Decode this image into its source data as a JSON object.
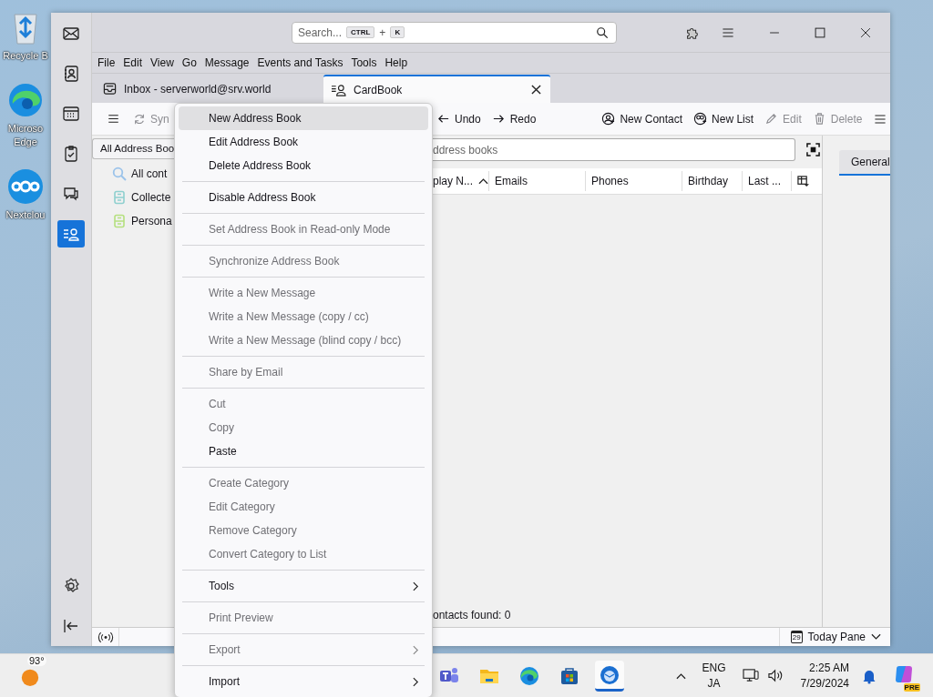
{
  "desktop_icons": [
    {
      "kind": "recycle",
      "label": "Recycle B"
    },
    {
      "kind": "edge",
      "label": "Microso Edge"
    },
    {
      "kind": "nextcloud",
      "label": "Nextclou"
    }
  ],
  "window": {
    "spaces": [
      {
        "kind": "mail",
        "selected": false
      },
      {
        "kind": "contacts",
        "selected": false
      },
      {
        "kind": "calendar",
        "selected": false
      },
      {
        "kind": "tasks",
        "selected": false
      },
      {
        "kind": "chat",
        "selected": false
      },
      {
        "kind": "cardbook",
        "selected": true
      }
    ],
    "search": {
      "placeholder": "Search...",
      "shortcut_keys": [
        "CTRL",
        "K"
      ],
      "shortcut_joiner": "+"
    },
    "menu_bar": [
      "File",
      "Edit",
      "View",
      "Go",
      "Message",
      "Events and Tasks",
      "Tools",
      "Help"
    ],
    "tabs": [
      {
        "kind": "mail",
        "label": "Inbox - serverworld@srv.world",
        "selected": false
      },
      {
        "kind": "cardbook",
        "label": "CardBook",
        "selected": true
      }
    ],
    "toolbar_left": [
      {
        "kind": "sync",
        "label": "Syn",
        "disabled": true
      }
    ],
    "toolbar_right": [
      {
        "kind": "undo",
        "label": "Undo",
        "disabled": false
      },
      {
        "kind": "redo",
        "label": "Redo",
        "disabled": false
      },
      {
        "kind": "new-contact",
        "label": "New Contact",
        "disabled": false
      },
      {
        "kind": "new-list",
        "label": "New List",
        "disabled": false
      },
      {
        "kind": "edit",
        "label": "Edit",
        "disabled": true
      },
      {
        "kind": "delete",
        "label": "Delete",
        "disabled": true
      }
    ],
    "address_book_select": "All Address Boo",
    "address_books": [
      {
        "kind": "search",
        "label": "All cont"
      },
      {
        "kind": "book",
        "label": "Collecte",
        "color": "#8fd0cf"
      },
      {
        "kind": "book",
        "label": "Persona",
        "color": "#b5e07f"
      }
    ],
    "filter": {
      "placeholder": "ddress books"
    },
    "columns": [
      {
        "label": "play N...",
        "sorted": true
      },
      {
        "label": "Emails",
        "sorted": false
      },
      {
        "label": "Phones",
        "sorted": false
      },
      {
        "label": "Birthday",
        "sorted": false
      },
      {
        "label": "Last ...",
        "sorted": false
      }
    ],
    "contacts_count": "ontacts found: 0",
    "detail_tabs": [
      {
        "label": "General",
        "selected": true
      }
    ],
    "status_bar": {
      "calendar_day": "29",
      "today_pane": "Today Pane"
    }
  },
  "context_menu": [
    {
      "kind": "item",
      "label": "New Address Book",
      "disabled": false,
      "selected": true,
      "submenu": false
    },
    {
      "kind": "item",
      "label": "Edit Address Book",
      "disabled": false,
      "selected": false,
      "submenu": false
    },
    {
      "kind": "item",
      "label": "Delete Address Book",
      "disabled": false,
      "selected": false,
      "submenu": false
    },
    {
      "kind": "separator"
    },
    {
      "kind": "item",
      "label": "Disable Address Book",
      "disabled": false,
      "selected": false,
      "submenu": false
    },
    {
      "kind": "separator"
    },
    {
      "kind": "item",
      "label": "Set Address Book in Read-only Mode",
      "disabled": true,
      "selected": false,
      "submenu": false
    },
    {
      "kind": "separator"
    },
    {
      "kind": "item",
      "label": "Synchronize Address Book",
      "disabled": true,
      "selected": false,
      "submenu": false
    },
    {
      "kind": "separator"
    },
    {
      "kind": "item",
      "label": "Write a New Message",
      "disabled": true,
      "selected": false,
      "submenu": false
    },
    {
      "kind": "item",
      "label": "Write a New Message (copy / cc)",
      "disabled": true,
      "selected": false,
      "submenu": false
    },
    {
      "kind": "item",
      "label": "Write a New Message (blind copy / bcc)",
      "disabled": true,
      "selected": false,
      "submenu": false
    },
    {
      "kind": "separator"
    },
    {
      "kind": "item",
      "label": "Share by Email",
      "disabled": true,
      "selected": false,
      "submenu": false
    },
    {
      "kind": "separator"
    },
    {
      "kind": "item",
      "label": "Cut",
      "disabled": true,
      "selected": false,
      "submenu": false
    },
    {
      "kind": "item",
      "label": "Copy",
      "disabled": true,
      "selected": false,
      "submenu": false
    },
    {
      "kind": "item",
      "label": "Paste",
      "disabled": false,
      "selected": false,
      "submenu": false
    },
    {
      "kind": "separator"
    },
    {
      "kind": "item",
      "label": "Create Category",
      "disabled": true,
      "selected": false,
      "submenu": false
    },
    {
      "kind": "item",
      "label": "Edit Category",
      "disabled": true,
      "selected": false,
      "submenu": false
    },
    {
      "kind": "item",
      "label": "Remove Category",
      "disabled": true,
      "selected": false,
      "submenu": false
    },
    {
      "kind": "item",
      "label": "Convert Category to List",
      "disabled": true,
      "selected": false,
      "submenu": false
    },
    {
      "kind": "separator"
    },
    {
      "kind": "item",
      "label": "Tools",
      "disabled": false,
      "selected": false,
      "submenu": true
    },
    {
      "kind": "separator"
    },
    {
      "kind": "item",
      "label": "Print Preview",
      "disabled": true,
      "selected": false,
      "submenu": false
    },
    {
      "kind": "separator"
    },
    {
      "kind": "item",
      "label": "Export",
      "disabled": true,
      "selected": false,
      "submenu": true
    },
    {
      "kind": "separator"
    },
    {
      "kind": "item",
      "label": "Import",
      "disabled": false,
      "selected": false,
      "submenu": true
    }
  ],
  "taskbar": {
    "weather": "93°",
    "apps": [
      {
        "kind": "teams",
        "active": false
      },
      {
        "kind": "folder",
        "active": false
      },
      {
        "kind": "edge",
        "active": false
      },
      {
        "kind": "store",
        "active": false
      },
      {
        "kind": "thunderbird",
        "active": true
      }
    ],
    "language": [
      "ENG",
      "JA"
    ],
    "time": "2:25 AM",
    "date": "7/29/2024",
    "copilot_badge": "PRE"
  }
}
